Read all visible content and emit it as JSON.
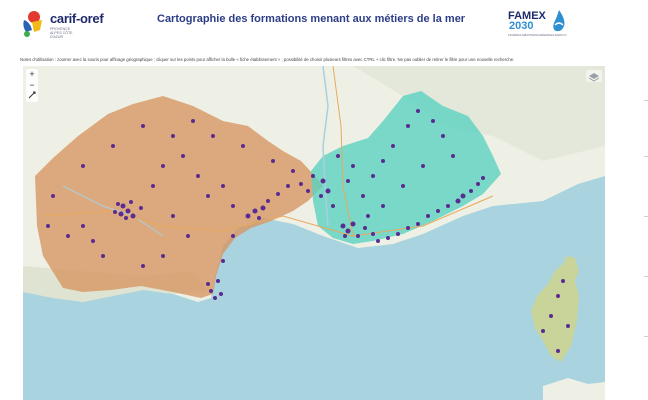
{
  "header": {
    "brand": "carif-oref",
    "brand_sub": "PROVENCE ALPES CÔTE D'AZUR",
    "title": "Cartographie des formations menant aux métiers de la mer",
    "partner_line1": "FAMEX",
    "partner_line2": "2030",
    "partner_sub": "FILIÈRES MÉDITERRANÉENNES EMPLOI"
  },
  "notes": "Notes d'utilisation : zoomer avec la souris pour affinage géographique ; cliquer sur les points pour afficher la bulle « fiche établissement » ; possibilité de choisir plusieurs filtres avec CTRL + clic filtre. Ne pas oublier de retirer le filtre pour une nouvelle recherche.",
  "map": {
    "zoom_in": "+",
    "zoom_out": "−",
    "layers_icon": "layers-icon",
    "regions": [
      {
        "name": "Occitanie",
        "color": "#d79560"
      },
      {
        "name": "Provence-Alpes-Côte d'Azur",
        "color": "#5bd2c0"
      },
      {
        "name": "Corse",
        "color": "#c8d49a"
      }
    ],
    "marker_color": "#5a2c91"
  }
}
